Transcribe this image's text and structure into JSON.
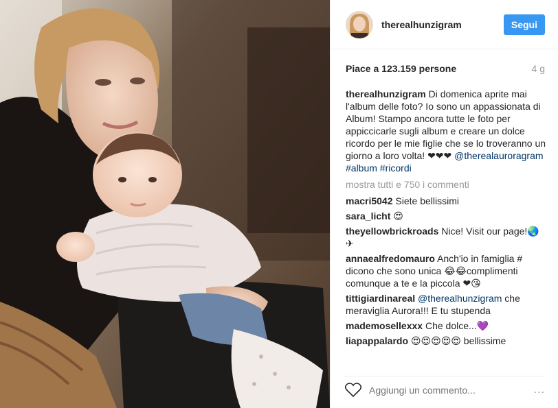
{
  "post": {
    "username": "therealhunzigram",
    "follow_label": "Segui",
    "likes": "Piace a 123.159 persone",
    "time": "4 g",
    "caption_user": "therealhunzigram",
    "caption_text": "Di domenica aprite mai l'album delle foto? Io sono un appassionata di Album! Stampo ancora tutte le foto per appiccicarle sugli album e creare un dolce ricordo per le mie figlie che se lo troveranno un giorno a loro volta! ❤❤❤",
    "caption_mention": "@therealauroragram",
    "caption_tags": "#album #ricordi",
    "view_all": "mostra tutti e 750 i commenti"
  },
  "comments": [
    {
      "user": "macri5042",
      "text": "Siete bellissimi"
    },
    {
      "user": "sara_licht",
      "text": "😍"
    },
    {
      "user": "theyellowbrickroads",
      "text": "Nice! Visit our page!🌏✈"
    },
    {
      "user": "annaealfredomauro",
      "text": "Anch'io in famiglia # dicono che sono unica 😂😂complimenti comunque a te e la piccola ❤😘"
    },
    {
      "user": "tittigiardinareal",
      "mention": "@therealhunzigram",
      "text": " che meraviglia Aurora!!! E tu stupenda"
    },
    {
      "user": "mademosellexxx",
      "text": "Che dolce...💜"
    },
    {
      "user": "liapappalardo",
      "text": "😍😍😍😍😍 bellissime"
    }
  ],
  "footer": {
    "placeholder": "Aggiungi un commento...",
    "more_icon": "..."
  },
  "colors": {
    "follow_blue": "#3897f0",
    "link_blue": "#003569",
    "muted": "#999999"
  }
}
